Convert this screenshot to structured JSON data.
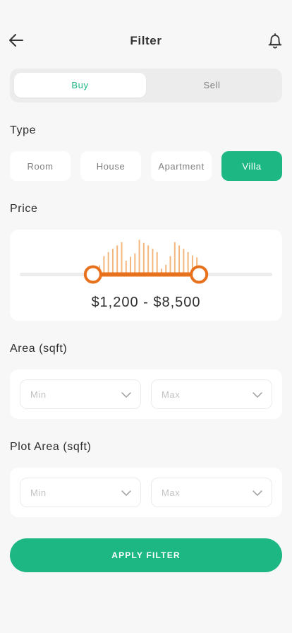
{
  "header": {
    "title": "Filter",
    "back_icon": "arrow-left-icon",
    "notify_icon": "bell-icon"
  },
  "mode": {
    "options": [
      "Buy",
      "Sell"
    ],
    "selected": "Buy"
  },
  "type": {
    "label": "Type",
    "options": [
      "Room",
      "House",
      "Apartment",
      "Villa"
    ],
    "selected": "Villa"
  },
  "price": {
    "label": "Price",
    "range_text": "$1,200 - $8,500",
    "min_fraction": 0.29,
    "max_fraction": 0.71,
    "histogram": [
      0.12,
      0.22,
      0.5,
      0.62,
      0.72,
      0.82,
      0.92,
      0.36,
      0.48,
      0.58,
      0.99,
      0.9,
      0.82,
      0.72,
      0.62,
      0.12,
      0.24,
      0.5,
      0.92,
      0.82,
      0.72,
      0.62,
      0.52,
      0.46
    ]
  },
  "area": {
    "label": "Area (sqft)",
    "min_placeholder": "Min",
    "max_placeholder": "Max"
  },
  "plot_area": {
    "label": "Plot Area (sqft)",
    "min_placeholder": "Min",
    "max_placeholder": "Max"
  },
  "apply_label": "APPLY FILTER",
  "colors": {
    "accent": "#1db784",
    "slider": "#e8711e",
    "histogram": "#f3b77d"
  }
}
